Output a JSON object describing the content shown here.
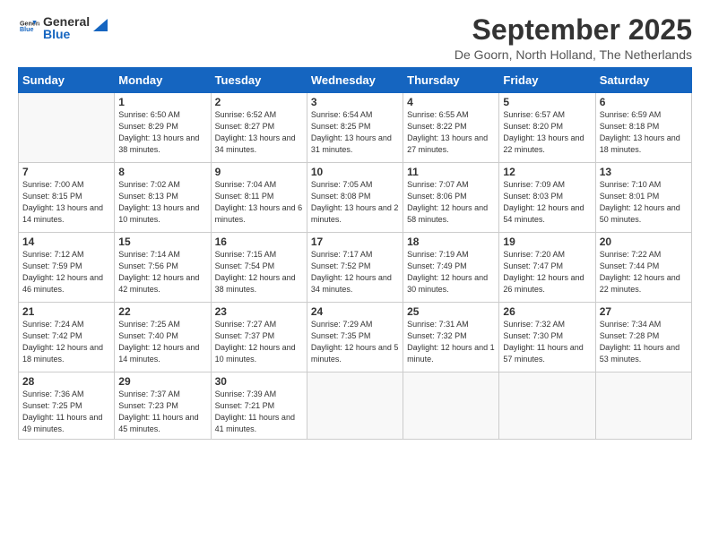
{
  "logo": {
    "general": "General",
    "blue": "Blue"
  },
  "header": {
    "month_title": "September 2025",
    "subtitle": "De Goorn, North Holland, The Netherlands"
  },
  "days_of_week": [
    "Sunday",
    "Monday",
    "Tuesday",
    "Wednesday",
    "Thursday",
    "Friday",
    "Saturday"
  ],
  "weeks": [
    [
      {
        "day": "",
        "info": ""
      },
      {
        "day": "1",
        "info": "Sunrise: 6:50 AM\nSunset: 8:29 PM\nDaylight: 13 hours\nand 38 minutes."
      },
      {
        "day": "2",
        "info": "Sunrise: 6:52 AM\nSunset: 8:27 PM\nDaylight: 13 hours\nand 34 minutes."
      },
      {
        "day": "3",
        "info": "Sunrise: 6:54 AM\nSunset: 8:25 PM\nDaylight: 13 hours\nand 31 minutes."
      },
      {
        "day": "4",
        "info": "Sunrise: 6:55 AM\nSunset: 8:22 PM\nDaylight: 13 hours\nand 27 minutes."
      },
      {
        "day": "5",
        "info": "Sunrise: 6:57 AM\nSunset: 8:20 PM\nDaylight: 13 hours\nand 22 minutes."
      },
      {
        "day": "6",
        "info": "Sunrise: 6:59 AM\nSunset: 8:18 PM\nDaylight: 13 hours\nand 18 minutes."
      }
    ],
    [
      {
        "day": "7",
        "info": "Sunrise: 7:00 AM\nSunset: 8:15 PM\nDaylight: 13 hours\nand 14 minutes."
      },
      {
        "day": "8",
        "info": "Sunrise: 7:02 AM\nSunset: 8:13 PM\nDaylight: 13 hours\nand 10 minutes."
      },
      {
        "day": "9",
        "info": "Sunrise: 7:04 AM\nSunset: 8:11 PM\nDaylight: 13 hours\nand 6 minutes."
      },
      {
        "day": "10",
        "info": "Sunrise: 7:05 AM\nSunset: 8:08 PM\nDaylight: 13 hours\nand 2 minutes."
      },
      {
        "day": "11",
        "info": "Sunrise: 7:07 AM\nSunset: 8:06 PM\nDaylight: 12 hours\nand 58 minutes."
      },
      {
        "day": "12",
        "info": "Sunrise: 7:09 AM\nSunset: 8:03 PM\nDaylight: 12 hours\nand 54 minutes."
      },
      {
        "day": "13",
        "info": "Sunrise: 7:10 AM\nSunset: 8:01 PM\nDaylight: 12 hours\nand 50 minutes."
      }
    ],
    [
      {
        "day": "14",
        "info": "Sunrise: 7:12 AM\nSunset: 7:59 PM\nDaylight: 12 hours\nand 46 minutes."
      },
      {
        "day": "15",
        "info": "Sunrise: 7:14 AM\nSunset: 7:56 PM\nDaylight: 12 hours\nand 42 minutes."
      },
      {
        "day": "16",
        "info": "Sunrise: 7:15 AM\nSunset: 7:54 PM\nDaylight: 12 hours\nand 38 minutes."
      },
      {
        "day": "17",
        "info": "Sunrise: 7:17 AM\nSunset: 7:52 PM\nDaylight: 12 hours\nand 34 minutes."
      },
      {
        "day": "18",
        "info": "Sunrise: 7:19 AM\nSunset: 7:49 PM\nDaylight: 12 hours\nand 30 minutes."
      },
      {
        "day": "19",
        "info": "Sunrise: 7:20 AM\nSunset: 7:47 PM\nDaylight: 12 hours\nand 26 minutes."
      },
      {
        "day": "20",
        "info": "Sunrise: 7:22 AM\nSunset: 7:44 PM\nDaylight: 12 hours\nand 22 minutes."
      }
    ],
    [
      {
        "day": "21",
        "info": "Sunrise: 7:24 AM\nSunset: 7:42 PM\nDaylight: 12 hours\nand 18 minutes."
      },
      {
        "day": "22",
        "info": "Sunrise: 7:25 AM\nSunset: 7:40 PM\nDaylight: 12 hours\nand 14 minutes."
      },
      {
        "day": "23",
        "info": "Sunrise: 7:27 AM\nSunset: 7:37 PM\nDaylight: 12 hours\nand 10 minutes."
      },
      {
        "day": "24",
        "info": "Sunrise: 7:29 AM\nSunset: 7:35 PM\nDaylight: 12 hours\nand 5 minutes."
      },
      {
        "day": "25",
        "info": "Sunrise: 7:31 AM\nSunset: 7:32 PM\nDaylight: 12 hours\nand 1 minute."
      },
      {
        "day": "26",
        "info": "Sunrise: 7:32 AM\nSunset: 7:30 PM\nDaylight: 11 hours\nand 57 minutes."
      },
      {
        "day": "27",
        "info": "Sunrise: 7:34 AM\nSunset: 7:28 PM\nDaylight: 11 hours\nand 53 minutes."
      }
    ],
    [
      {
        "day": "28",
        "info": "Sunrise: 7:36 AM\nSunset: 7:25 PM\nDaylight: 11 hours\nand 49 minutes."
      },
      {
        "day": "29",
        "info": "Sunrise: 7:37 AM\nSunset: 7:23 PM\nDaylight: 11 hours\nand 45 minutes."
      },
      {
        "day": "30",
        "info": "Sunrise: 7:39 AM\nSunset: 7:21 PM\nDaylight: 11 hours\nand 41 minutes."
      },
      {
        "day": "",
        "info": ""
      },
      {
        "day": "",
        "info": ""
      },
      {
        "day": "",
        "info": ""
      },
      {
        "day": "",
        "info": ""
      }
    ]
  ]
}
